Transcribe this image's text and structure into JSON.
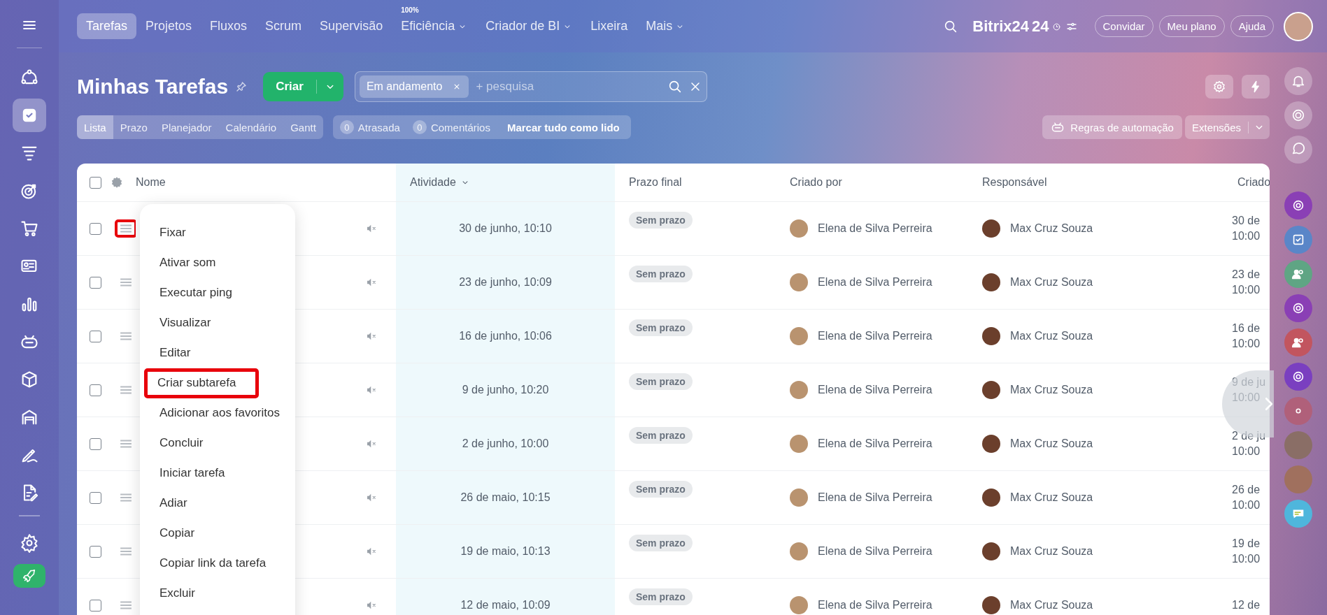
{
  "top_nav": {
    "items": [
      {
        "label": "Tarefas",
        "selected": true,
        "dropdown": false
      },
      {
        "label": "Projetos",
        "selected": false,
        "dropdown": false
      },
      {
        "label": "Fluxos",
        "selected": false,
        "dropdown": false
      },
      {
        "label": "Scrum",
        "selected": false,
        "dropdown": false
      },
      {
        "label": "Supervisão",
        "selected": false,
        "dropdown": false
      },
      {
        "label": "Eficiência",
        "selected": false,
        "dropdown": true,
        "badge": "100%"
      },
      {
        "label": "Criador de BI",
        "selected": false,
        "dropdown": true
      },
      {
        "label": "Lixeira",
        "selected": false,
        "dropdown": false
      },
      {
        "label": "Mais",
        "selected": false,
        "dropdown": true
      }
    ],
    "brand": "Bitrix24",
    "brand_suffix": "24",
    "buttons": [
      "Convidar",
      "Meu plano",
      "Ajuda"
    ]
  },
  "page": {
    "title": "Minhas Tarefas",
    "create_button": "Criar",
    "filter_chip": "Em andamento",
    "search_placeholder": "+ pesquisa"
  },
  "view_tabs": [
    {
      "label": "Lista",
      "selected": true
    },
    {
      "label": "Prazo",
      "selected": false
    },
    {
      "label": "Planejador",
      "selected": false
    },
    {
      "label": "Calendário",
      "selected": false
    },
    {
      "label": "Gantt",
      "selected": false
    }
  ],
  "counters": [
    {
      "count": "0",
      "label": "Atrasada"
    },
    {
      "count": "0",
      "label": "Comentários"
    }
  ],
  "mark_all_read": "Marcar tudo como lido",
  "automation_button": "Regras de automação",
  "extensions_button": "Extensões",
  "table": {
    "select_all_checked": false,
    "columns": [
      {
        "label": "Nome",
        "sorted": false
      },
      {
        "label": "Atividade",
        "sorted": true
      },
      {
        "label": "Prazo final",
        "sorted": false
      },
      {
        "label": "Criado por",
        "sorted": false
      },
      {
        "label": "Responsável",
        "sorted": false
      },
      {
        "label": "Criado",
        "sorted": false
      }
    ],
    "rows": [
      {
        "checked": false,
        "activity": "30 de junho, 10:10",
        "deadline": "Sem prazo",
        "creator": "Elena de Silva Perreira",
        "responsible": "Max Cruz Souza",
        "created_date": "30 de",
        "created_time": "10:00",
        "handle_highlighted": true
      },
      {
        "checked": false,
        "activity": "23 de junho, 10:09",
        "deadline": "Sem prazo",
        "creator": "Elena de Silva Perreira",
        "responsible": "Max Cruz Souza",
        "created_date": "23 de",
        "created_time": "10:00",
        "handle_highlighted": false
      },
      {
        "checked": false,
        "activity": "16 de junho, 10:06",
        "deadline": "Sem prazo",
        "creator": "Elena de Silva Perreira",
        "responsible": "Max Cruz Souza",
        "created_date": "16 de",
        "created_time": "10:00",
        "handle_highlighted": false
      },
      {
        "checked": false,
        "activity": "9 de junho, 10:20",
        "deadline": "Sem prazo",
        "creator": "Elena de Silva Perreira",
        "responsible": "Max Cruz Souza",
        "created_date": "9 de ju",
        "created_time": "10:00",
        "handle_highlighted": false
      },
      {
        "checked": false,
        "activity": "2 de junho, 10:00",
        "deadline": "Sem prazo",
        "creator": "Elena de Silva Perreira",
        "responsible": "Max Cruz Souza",
        "created_date": "2 de ju",
        "created_time": "10:00",
        "handle_highlighted": false
      },
      {
        "checked": false,
        "activity": "26 de maio, 10:15",
        "deadline": "Sem prazo",
        "creator": "Elena de Silva Perreira",
        "responsible": "Max Cruz Souza",
        "created_date": "26 de",
        "created_time": "10:00",
        "handle_highlighted": false
      },
      {
        "checked": false,
        "activity": "19 de maio, 10:13",
        "deadline": "Sem prazo",
        "creator": "Elena de Silva Perreira",
        "responsible": "Max Cruz Souza",
        "created_date": "19 de",
        "created_time": "10:00",
        "handle_highlighted": false
      },
      {
        "checked": false,
        "activity": "12 de maio, 10:09",
        "deadline": "Sem prazo",
        "creator": "Elena de Silva Perreira",
        "responsible": "Max Cruz Souza",
        "created_date": "12 de",
        "handle_highlighted": false
      }
    ]
  },
  "context_menu": {
    "items": [
      {
        "label": "Fixar",
        "highlighted": false
      },
      {
        "label": "Ativar som",
        "highlighted": false
      },
      {
        "label": "Executar ping",
        "highlighted": false
      },
      {
        "label": "Visualizar",
        "highlighted": false
      },
      {
        "label": "Editar",
        "highlighted": false
      },
      {
        "label": "Criar subtarefa",
        "highlighted": true
      },
      {
        "label": "Adicionar aos favoritos",
        "highlighted": false
      },
      {
        "label": "Concluir",
        "highlighted": false
      },
      {
        "label": "Iniciar tarefa",
        "highlighted": false
      },
      {
        "label": "Adiar",
        "highlighted": false
      },
      {
        "label": "Copiar",
        "highlighted": false
      },
      {
        "label": "Copiar link da tarefa",
        "highlighted": false
      },
      {
        "label": "Excluir",
        "highlighted": false
      }
    ]
  }
}
